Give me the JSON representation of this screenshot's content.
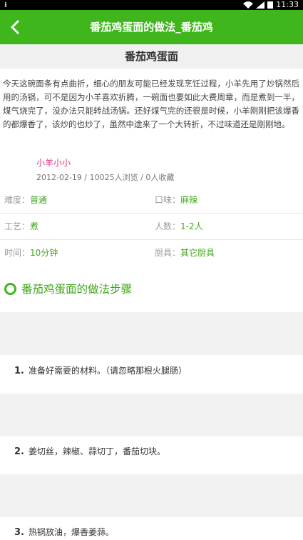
{
  "status_bar": {
    "time": "11:33"
  },
  "app_bar": {
    "title": "番茄鸡蛋面的做法_番茄鸡"
  },
  "recipe": {
    "name": "番茄鸡蛋面",
    "intro": "今天这碗面条有点曲折，细心的朋友可能已经发现烹饪过程，小羊先用了炒锅然后用的汤锅，可不是因为小羊喜欢折腾，一碗面也要如此大费周章，而是煮到一半，煤气烧完了，没办法只能转战汤锅。还好煤气完的还很是时候，小羊刚刚把该爆香的都爆香了，该炒的也炒了，虽然中途来了一个大转折，不过味道还是刚刚地。",
    "author": "小羊小小",
    "meta": "2012-02-19 / 10025人浏览 / 0人收藏"
  },
  "attributes": [
    {
      "label": "难度：",
      "value": "普通"
    },
    {
      "label": "口味：",
      "value": "麻辣"
    },
    {
      "label": "工艺：",
      "value": "煮"
    },
    {
      "label": "人数：",
      "value": "1-2人"
    },
    {
      "label": "时间：",
      "value": "10分钟"
    },
    {
      "label": "厨具：",
      "value": "其它厨具"
    }
  ],
  "steps_header": "番茄鸡蛋面的做法步骤",
  "steps": [
    {
      "num": "1.",
      "text": "准备好需要的材料。（请忽略那根火腿肠）"
    },
    {
      "num": "2.",
      "text": "姜切丝，辣椒、蒜切丁，番茄切块。"
    },
    {
      "num": "3.",
      "text": "热锅放油，爆香姜蒜。"
    }
  ],
  "colors": {
    "brand_green": "#3fb61c",
    "author_pink": "#e0338a"
  }
}
